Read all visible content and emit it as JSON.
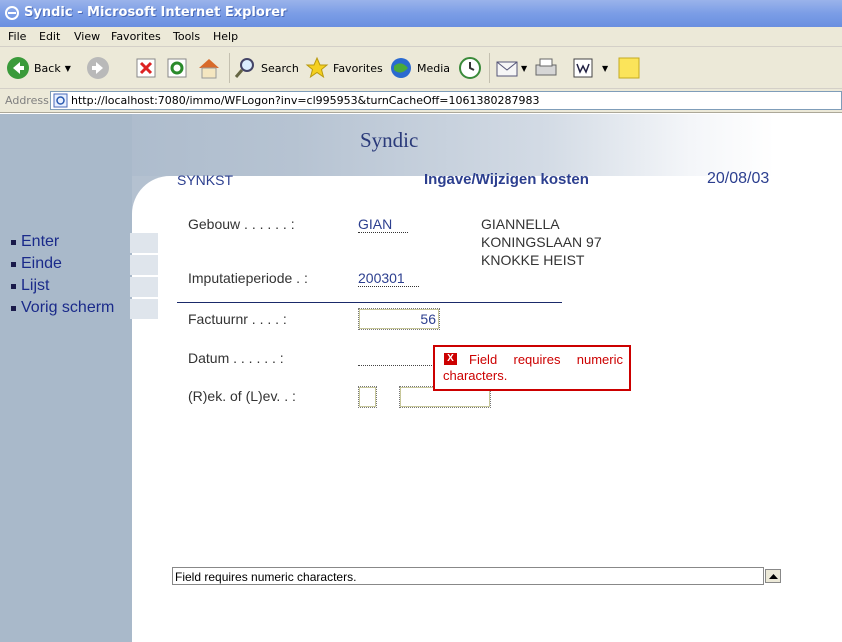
{
  "window": {
    "title": "Syndic - Microsoft Internet Explorer"
  },
  "menu": [
    "File",
    "Edit",
    "View",
    "Favorites",
    "Tools",
    "Help"
  ],
  "toolbar": {
    "back": "Back",
    "search": "Search",
    "favorites": "Favorites",
    "media": "Media"
  },
  "address": {
    "label": "Address",
    "url": "http://localhost:7080/immo/WFLogon?inv=cl995953&turnCacheOff=1061380287983"
  },
  "app": {
    "title": "Syndic"
  },
  "header": {
    "code": "SYNKST",
    "title": "Ingave/Wijzigen kosten",
    "date": "20/08/03"
  },
  "nav": [
    {
      "label": "Enter"
    },
    {
      "label": "Einde"
    },
    {
      "label": "Lijst"
    },
    {
      "label": "Vorig scherm"
    }
  ],
  "form": {
    "gebouw_label": "Gebouw . . . . . . :",
    "gebouw_code": "GIAN",
    "address_lines": [
      "GIANNELLA",
      "KONINGSLAAN 97",
      "KNOKKE HEIST"
    ],
    "imputatie_label": "Imputatieperiode . :",
    "imputatie_value": "200301",
    "factuur_label": "Factuurnr  . . . . :",
    "factuur_value": "56",
    "datum_label": "Datum  . . . . . . :",
    "datum_value": "",
    "rek_label": "(R)ek. of (L)ev. . :",
    "rek_value": "",
    "rek_extra_value": ""
  },
  "error": {
    "icon": "close-icon",
    "message": "Field requires numeric characters."
  },
  "status": {
    "message": "Field requires numeric characters."
  }
}
